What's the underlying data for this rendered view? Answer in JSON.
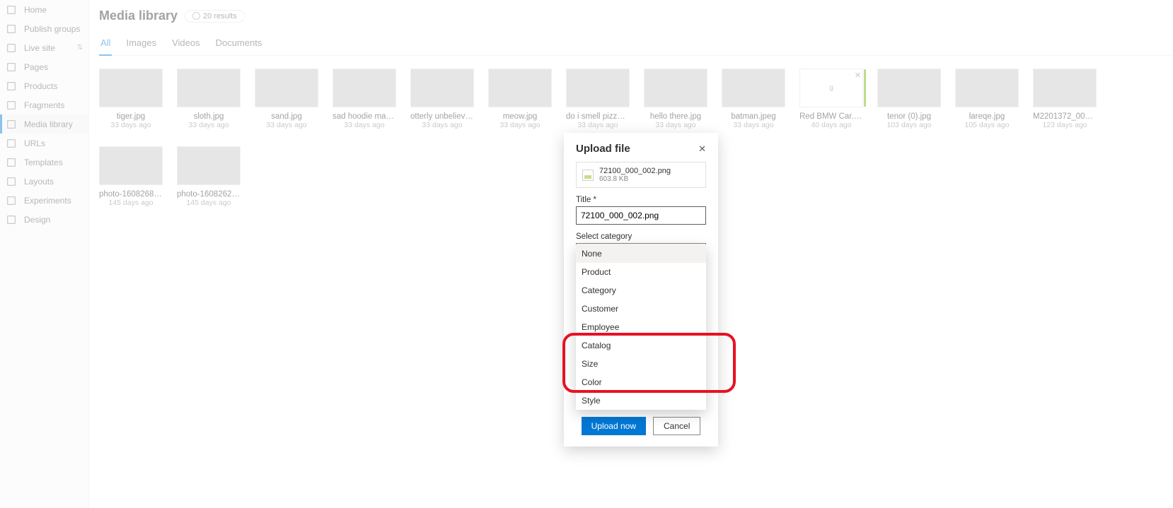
{
  "sidebar": {
    "items": [
      {
        "label": "Home",
        "icon": "home-icon"
      },
      {
        "label": "Publish groups",
        "icon": "rocket-icon"
      },
      {
        "label": "Live site",
        "icon": "broadcast-icon",
        "updown": true
      },
      {
        "label": "Pages",
        "icon": "page-icon"
      },
      {
        "label": "Products",
        "icon": "product-icon"
      },
      {
        "label": "Fragments",
        "icon": "fragment-icon"
      },
      {
        "label": "Media library",
        "icon": "media-icon",
        "active": true
      },
      {
        "label": "URLs",
        "icon": "link-icon"
      },
      {
        "label": "Templates",
        "icon": "template-icon"
      },
      {
        "label": "Layouts",
        "icon": "layout-icon"
      },
      {
        "label": "Experiments",
        "icon": "flask-icon"
      },
      {
        "label": "Design",
        "icon": "design-icon"
      }
    ]
  },
  "header": {
    "title": "Media library",
    "results": "20 results"
  },
  "tabs": [
    {
      "label": "All",
      "selected": true
    },
    {
      "label": "Images"
    },
    {
      "label": "Videos"
    },
    {
      "label": "Documents"
    }
  ],
  "media": [
    {
      "name": "tiger.jpg",
      "age": "33 days ago"
    },
    {
      "name": "sloth.jpg",
      "age": "33 days ago"
    },
    {
      "name": "sand.jpg",
      "age": "33 days ago"
    },
    {
      "name": "sad hoodie man.jpg",
      "age": "33 days ago"
    },
    {
      "name": "otterly unbelievable.j...",
      "age": "33 days ago"
    },
    {
      "name": "meow.jpg",
      "age": "33 days ago"
    },
    {
      "name": "do i smell pizza.jpg",
      "age": "33 days ago"
    },
    {
      "name": "hello there.jpg",
      "age": "33 days ago"
    },
    {
      "name": "batman.jpeg",
      "age": "33 days ago"
    },
    {
      "name": "Red BMW Car.jpg",
      "age": "40 days ago",
      "uploading": true
    },
    {
      "name": "tenor (0).jpg",
      "age": "103 days ago"
    },
    {
      "name": "lareqe.jpg",
      "age": "105 days ago"
    },
    {
      "name": "M2201372_000_002.p...",
      "age": "123 days ago"
    },
    {
      "name": "photo-160826862760...",
      "age": "145 days ago"
    },
    {
      "name": "photo-160826294108...",
      "age": "145 days ago"
    }
  ],
  "modal": {
    "title": "Upload file",
    "file": {
      "name": "72100_000_002.png",
      "size": "603.8 KB"
    },
    "title_field_label": "Title",
    "title_field_value": "72100_000_002.png",
    "category_label": "Select category",
    "category_value": "None",
    "options": [
      "None",
      "Product",
      "Category",
      "Customer",
      "Employee",
      "Catalog",
      "Size",
      "Color",
      "Style"
    ],
    "primary": "Upload now",
    "secondary": "Cancel"
  }
}
